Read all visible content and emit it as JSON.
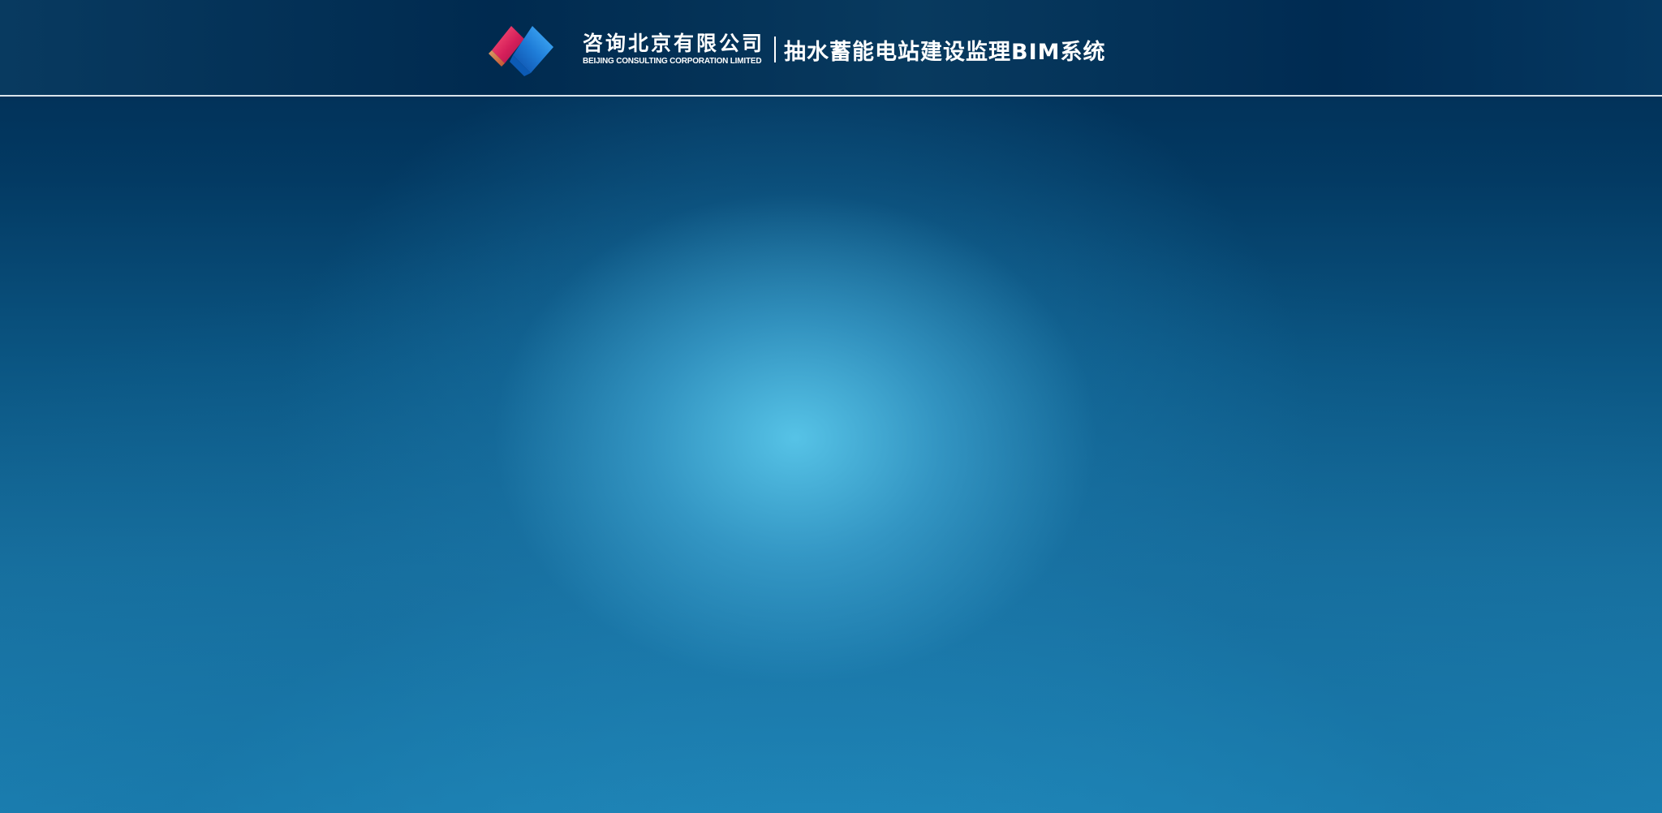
{
  "header": {
    "logo_icon": "company-logo-icon",
    "company_name_cn": "咨询北京有限公司",
    "company_name_en": "BEIJING CONSULTING CORPORATION LIMITED",
    "system_title": "抽水蓄能电站建设监理BIM系统"
  },
  "colors": {
    "header_bg": "#002a4f",
    "header_line": "#e6eef4",
    "glow_center": "#5ac8eb",
    "background_bottom": "#1c83b5",
    "logo_red": "#d51f5a",
    "logo_blue": "#1f7dd8"
  }
}
